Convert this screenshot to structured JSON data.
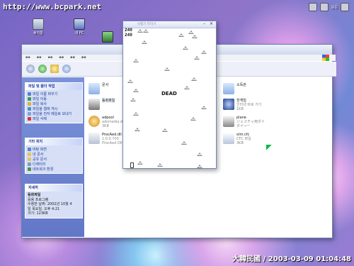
{
  "watermark": "http://www.bcpark.net",
  "tray": {
    "label": "모든"
  },
  "desktop_icons": [
    {
      "label": "휴지통",
      "icon": "trash-icon"
    },
    {
      "label": "내 PC",
      "icon": "computer-icon"
    }
  ],
  "explorer": {
    "task_sections": [
      {
        "title": "파일 및 폴더 작업",
        "items": [
          "파일 이름 바꾸기",
          "파일 이동",
          "파일 복사",
          "파일을 웹에 게시",
          "파일을 전자 메일로 보내기",
          "파일 삭제"
        ]
      },
      {
        "title": "기타 위치",
        "items": [
          "바탕 화면",
          "내 문서",
          "공유 문서",
          "디렉터리",
          "네트워크 환경"
        ]
      },
      {
        "title": "자세히",
        "details": [
          "동화파일",
          "응용 프로그램",
          "수정한 날짜: 2002년 10월 4",
          "일 목요일, 오후 4:21",
          "크기: 123KB"
        ]
      }
    ],
    "files": [
      {
        "name": "문서",
        "sub": "",
        "icon": "folder-icon"
      },
      {
        "name": "동화파일",
        "sub": "",
        "icon": "app-icon"
      },
      {
        "name": "adpool",
        "sub": "adsmedia.dll",
        "sub2": "3KB",
        "icon": "file-icon"
      },
      {
        "name": "ProcAed.dll",
        "sub": "1.0.0.703",
        "sub2": "ProcAed Dll",
        "icon": "dll-icon"
      },
      {
        "name": "소독관",
        "sub": "",
        "icon": "folder-icon"
      },
      {
        "name": "한게임",
        "sub": "인터넷 바로 가기",
        "sub2": "1KB",
        "icon": "shortcut-icon"
      },
      {
        "name": "plane",
        "sub": "ジェスチャ用ダイ",
        "sub2": "ダイ→ー",
        "icon": "plane-icon"
      },
      {
        "name": "stm.cfc",
        "sub": "CFC 파일",
        "sub2": "3KB",
        "icon": "cfc-icon"
      }
    ]
  },
  "game": {
    "title": "비행기 피하기",
    "score_top": "240",
    "score_second": "240",
    "status": "DEAD"
  },
  "timestamp_stamp": "大韓民國 / 2003-03-09 01:04:48"
}
